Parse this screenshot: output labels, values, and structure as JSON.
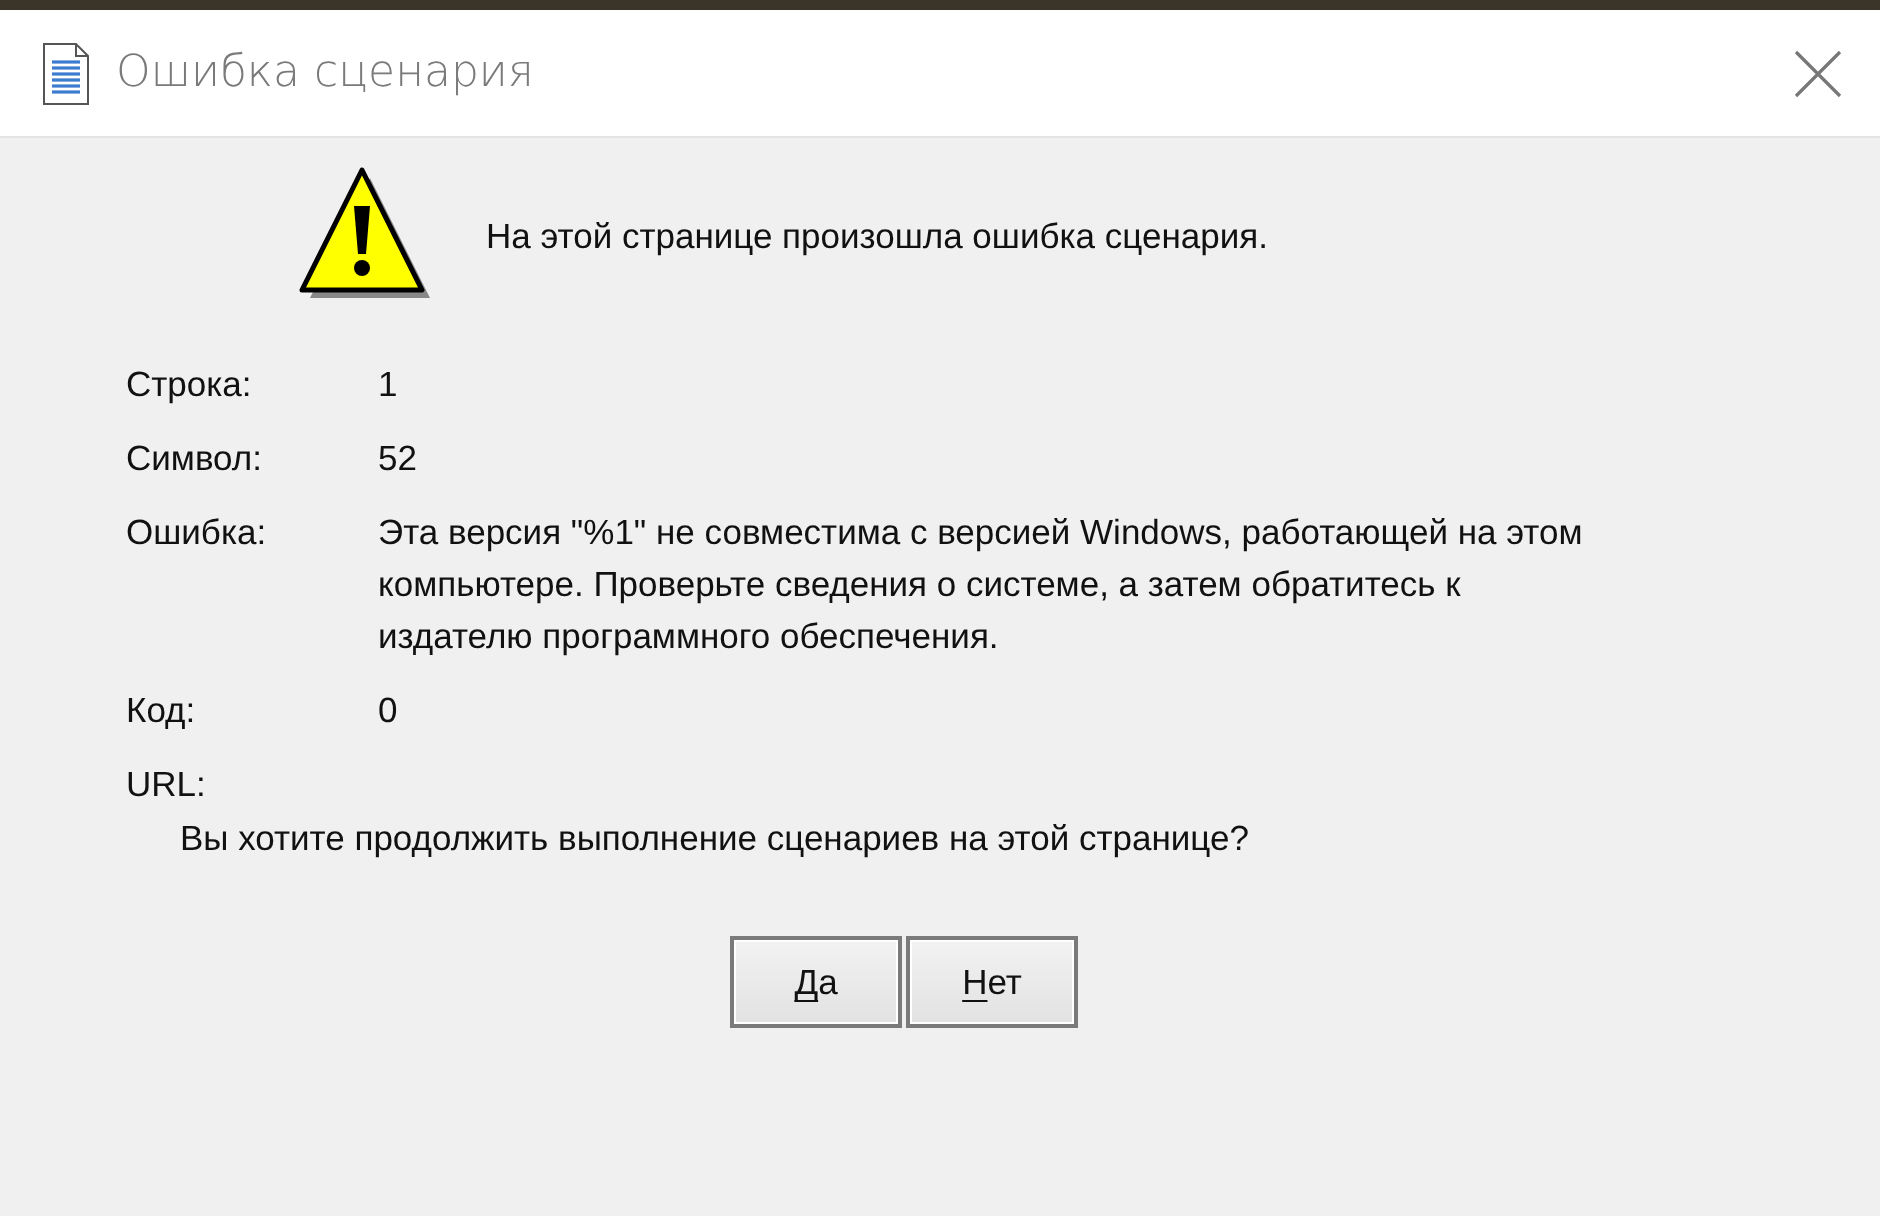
{
  "window": {
    "title": "Ошибка сценария"
  },
  "message": "На этой странице произошла ошибка сценария.",
  "details": [
    {
      "label": "Строка:",
      "value": "1"
    },
    {
      "label": "Символ:",
      "value": "52"
    },
    {
      "label": "Ошибка:",
      "value": "Эта версия \"%1\" не совместима с версией Windows, работающей на этом компьютере. Проверьте сведения о системе, а затем обратитесь к издателю программного обеспечения."
    },
    {
      "label": "Код:",
      "value": "0"
    },
    {
      "label": "URL:"
    }
  ],
  "question": "Вы хотите продолжить выполнение сценариев на этой странице?",
  "buttons": [
    {
      "label": "Да",
      "mnemonic_underlined": true
    },
    {
      "label": "Нет",
      "mnemonic_underlined": true
    }
  ]
}
